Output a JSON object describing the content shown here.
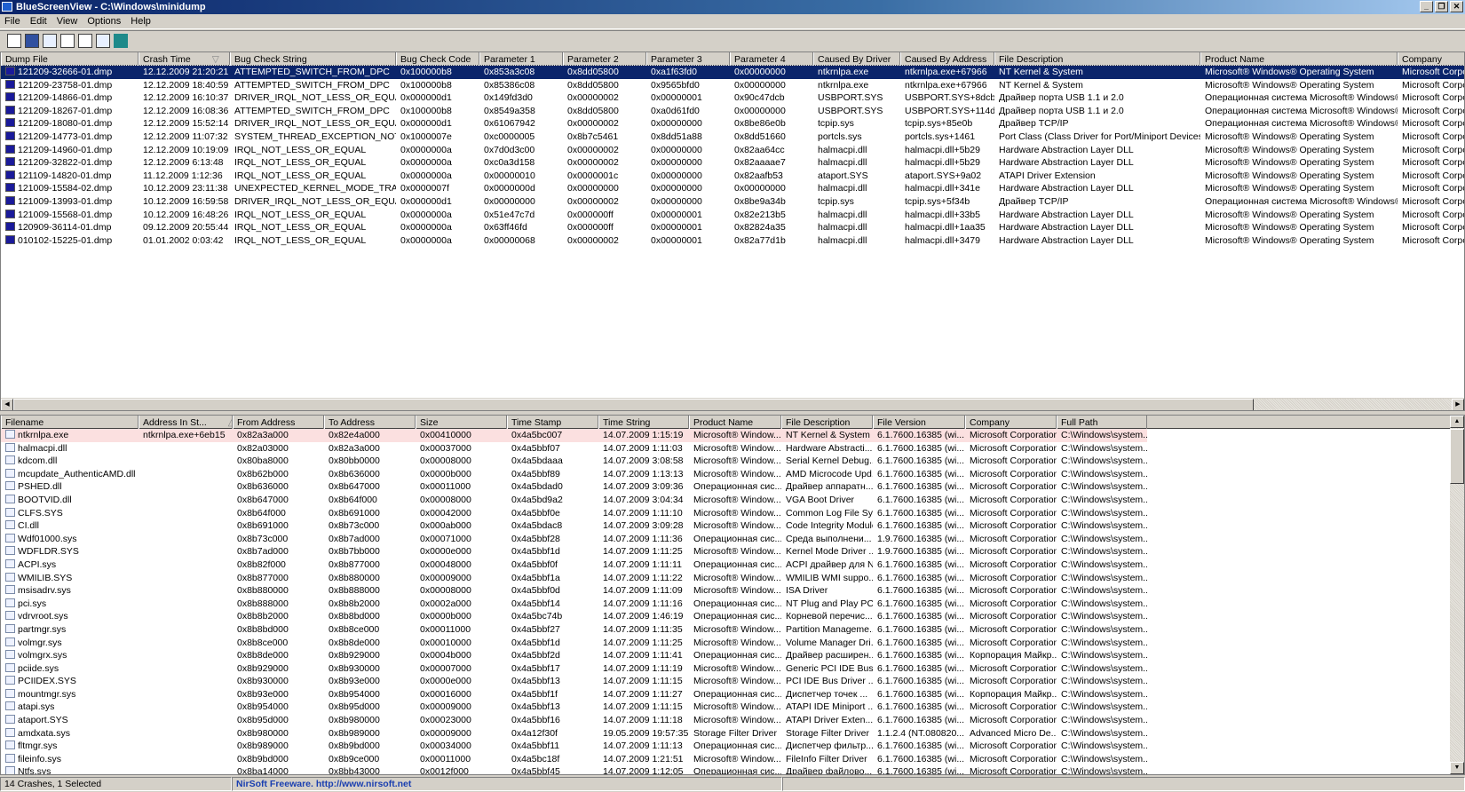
{
  "window": {
    "title": "BlueScreenView  -  C:\\Windows\\minidump",
    "minimize": "_",
    "restore": "❐",
    "close": "✕"
  },
  "menu": [
    "File",
    "Edit",
    "View",
    "Options",
    "Help"
  ],
  "toolbar": [
    "properties-icon",
    "save-icon",
    "refresh-icon",
    "copy-icon",
    "options-icon",
    "find-icon",
    "exit-icon"
  ],
  "crashes": {
    "columns": [
      "Dump File",
      "Crash Time",
      "Bug Check String",
      "Bug Check Code",
      "Parameter 1",
      "Parameter 2",
      "Parameter 3",
      "Parameter 4",
      "Caused By Driver",
      "Caused By Address",
      "File Description",
      "Product Name",
      "Company"
    ],
    "sort_column": "Crash Time",
    "sort_indicator": "▽",
    "selected_index": 0,
    "rows": [
      [
        "121209-32666-01.dmp",
        "12.12.2009 21:20:21",
        "ATTEMPTED_SWITCH_FROM_DPC",
        "0x100000b8",
        "0x853a3c08",
        "0x8dd05800",
        "0xa1f63fd0",
        "0x00000000",
        "ntkrnlpa.exe",
        "ntkrnlpa.exe+67966",
        "NT Kernel & System",
        "Microsoft® Windows® Operating System",
        "Microsoft Corpora"
      ],
      [
        "121209-23758-01.dmp",
        "12.12.2009 18:40:59",
        "ATTEMPTED_SWITCH_FROM_DPC",
        "0x100000b8",
        "0x85386c08",
        "0x8dd05800",
        "0x9565bfd0",
        "0x00000000",
        "ntkrnlpa.exe",
        "ntkrnlpa.exe+67966",
        "NT Kernel & System",
        "Microsoft® Windows® Operating System",
        "Microsoft Corpora"
      ],
      [
        "121209-14866-01.dmp",
        "12.12.2009 16:10:37",
        "DRIVER_IRQL_NOT_LESS_OR_EQUAL",
        "0x000000d1",
        "0x149fd3d0",
        "0x00000002",
        "0x00000001",
        "0x90c47dcb",
        "USBPORT.SYS",
        "USBPORT.SYS+8dcb",
        "Драйвер порта USB 1.1 и 2.0",
        "Операционная система Microsoft® Windows®",
        "Microsoft Corpora"
      ],
      [
        "121209-18267-01.dmp",
        "12.12.2009 16:08:36",
        "ATTEMPTED_SWITCH_FROM_DPC",
        "0x100000b8",
        "0x8549a358",
        "0x8dd05800",
        "0xa0d61fd0",
        "0x00000000",
        "USBPORT.SYS",
        "USBPORT.SYS+114d",
        "Драйвер порта USB 1.1 и 2.0",
        "Операционная система Microsoft® Windows®",
        "Microsoft Corpora"
      ],
      [
        "121209-18080-01.dmp",
        "12.12.2009 15:52:14",
        "DRIVER_IRQL_NOT_LESS_OR_EQUAL",
        "0x000000d1",
        "0x61067942",
        "0x00000002",
        "0x00000000",
        "0x8be86e0b",
        "tcpip.sys",
        "tcpip.sys+85e0b",
        "Драйвер TCP/IP",
        "Операционная система Microsoft® Windows®",
        "Microsoft Corpora"
      ],
      [
        "121209-14773-01.dmp",
        "12.12.2009 11:07:32",
        "SYSTEM_THREAD_EXCEPTION_NOT_H...",
        "0x1000007e",
        "0xc0000005",
        "0x8b7c5461",
        "0x8dd51a88",
        "0x8dd51660",
        "portcls.sys",
        "portcls.sys+1461",
        "Port Class (Class Driver for Port/Miniport Devices)",
        "Microsoft® Windows® Operating System",
        "Microsoft Corpora"
      ],
      [
        "121209-14960-01.dmp",
        "12.12.2009 10:19:09",
        "IRQL_NOT_LESS_OR_EQUAL",
        "0x0000000a",
        "0x7d0d3c00",
        "0x00000002",
        "0x00000000",
        "0x82aa64cc",
        "halmacpi.dll",
        "halmacpi.dll+5b29",
        "Hardware Abstraction Layer DLL",
        "Microsoft® Windows® Operating System",
        "Microsoft Corpora"
      ],
      [
        "121209-32822-01.dmp",
        "12.12.2009 6:13:48",
        "IRQL_NOT_LESS_OR_EQUAL",
        "0x0000000a",
        "0xc0a3d158",
        "0x00000002",
        "0x00000000",
        "0x82aaaae7",
        "halmacpi.dll",
        "halmacpi.dll+5b29",
        "Hardware Abstraction Layer DLL",
        "Microsoft® Windows® Operating System",
        "Microsoft Corpora"
      ],
      [
        "121109-14820-01.dmp",
        "11.12.2009 1:12:36",
        "IRQL_NOT_LESS_OR_EQUAL",
        "0x0000000a",
        "0x00000010",
        "0x0000001c",
        "0x00000000",
        "0x82aafb53",
        "ataport.SYS",
        "ataport.SYS+9a02",
        "ATAPI Driver Extension",
        "Microsoft® Windows® Operating System",
        "Microsoft Corpora"
      ],
      [
        "121009-15584-02.dmp",
        "10.12.2009 23:11:38",
        "UNEXPECTED_KERNEL_MODE_TRAP",
        "0x0000007f",
        "0x0000000d",
        "0x00000000",
        "0x00000000",
        "0x00000000",
        "halmacpi.dll",
        "halmacpi.dll+341e",
        "Hardware Abstraction Layer DLL",
        "Microsoft® Windows® Operating System",
        "Microsoft Corpora"
      ],
      [
        "121009-13993-01.dmp",
        "10.12.2009 16:59:58",
        "DRIVER_IRQL_NOT_LESS_OR_EQUAL",
        "0x000000d1",
        "0x00000000",
        "0x00000002",
        "0x00000000",
        "0x8be9a34b",
        "tcpip.sys",
        "tcpip.sys+5f34b",
        "Драйвер TCP/IP",
        "Операционная система Microsoft® Windows®",
        "Microsoft Corpora"
      ],
      [
        "121009-15568-01.dmp",
        "10.12.2009 16:48:26",
        "IRQL_NOT_LESS_OR_EQUAL",
        "0x0000000a",
        "0x51e47c7d",
        "0x000000ff",
        "0x00000001",
        "0x82e213b5",
        "halmacpi.dll",
        "halmacpi.dll+33b5",
        "Hardware Abstraction Layer DLL",
        "Microsoft® Windows® Operating System",
        "Microsoft Corpora"
      ],
      [
        "120909-36114-01.dmp",
        "09.12.2009 20:55:44",
        "IRQL_NOT_LESS_OR_EQUAL",
        "0x0000000a",
        "0x63ff46fd",
        "0x000000ff",
        "0x00000001",
        "0x82824a35",
        "halmacpi.dll",
        "halmacpi.dll+1aa35",
        "Hardware Abstraction Layer DLL",
        "Microsoft® Windows® Operating System",
        "Microsoft Corpora"
      ],
      [
        "010102-15225-01.dmp",
        "01.01.2002 0:03:42",
        "IRQL_NOT_LESS_OR_EQUAL",
        "0x0000000a",
        "0x00000068",
        "0x00000002",
        "0x00000001",
        "0x82a77d1b",
        "halmacpi.dll",
        "halmacpi.dll+3479",
        "Hardware Abstraction Layer DLL",
        "Microsoft® Windows® Operating System",
        "Microsoft Corpora"
      ]
    ]
  },
  "modules": {
    "columns": [
      "Filename",
      "Address In St...",
      "From Address",
      "To Address",
      "Size",
      "Time Stamp",
      "Time String",
      "Product Name",
      "File Description",
      "File Version",
      "Company",
      "Full Path"
    ],
    "sort_column": "Address In St...",
    "sort_indicator": "△",
    "highlight_index": 0,
    "highlight_color": "#fbe0e0",
    "rows": [
      [
        "ntkrnlpa.exe",
        "ntkrnlpa.exe+6eb15",
        "0x82a3a000",
        "0x82e4a000",
        "0x00410000",
        "0x4a5bc007",
        "14.07.2009 1:15:19",
        "Microsoft® Window...",
        "NT Kernel & System",
        "6.1.7600.16385 (wi...",
        "Microsoft Corporation",
        "C:\\Windows\\system..."
      ],
      [
        "halmacpi.dll",
        "",
        "0x82a03000",
        "0x82a3a000",
        "0x00037000",
        "0x4a5bbf07",
        "14.07.2009 1:11:03",
        "Microsoft® Window...",
        "Hardware Abstracti...",
        "6.1.7600.16385 (wi...",
        "Microsoft Corporation",
        "C:\\Windows\\system..."
      ],
      [
        "kdcom.dll",
        "",
        "0x80ba8000",
        "0x80bb0000",
        "0x00008000",
        "0x4a5bdaaa",
        "14.07.2009 3:08:58",
        "Microsoft® Window...",
        "Serial Kernel Debug...",
        "6.1.7600.16385 (wi...",
        "Microsoft Corporation",
        "C:\\Windows\\system..."
      ],
      [
        "mcupdate_AuthenticAMD.dll",
        "",
        "0x8b62b000",
        "0x8b636000",
        "0x0000b000",
        "0x4a5bbf89",
        "14.07.2009 1:13:13",
        "Microsoft® Window...",
        "AMD Microcode Upd...",
        "6.1.7600.16385 (wi...",
        "Microsoft Corporation",
        "C:\\Windows\\system..."
      ],
      [
        "PSHED.dll",
        "",
        "0x8b636000",
        "0x8b647000",
        "0x00011000",
        "0x4a5bdad0",
        "14.07.2009 3:09:36",
        "Операционная сис...",
        "Драйвер аппаратн...",
        "6.1.7600.16385 (wi...",
        "Microsoft Corporation",
        "C:\\Windows\\system..."
      ],
      [
        "BOOTVID.dll",
        "",
        "0x8b647000",
        "0x8b64f000",
        "0x00008000",
        "0x4a5bd9a2",
        "14.07.2009 3:04:34",
        "Microsoft® Window...",
        "VGA Boot Driver",
        "6.1.7600.16385 (wi...",
        "Microsoft Corporation",
        "C:\\Windows\\system..."
      ],
      [
        "CLFS.SYS",
        "",
        "0x8b64f000",
        "0x8b691000",
        "0x00042000",
        "0x4a5bbf0e",
        "14.07.2009 1:11:10",
        "Microsoft® Window...",
        "Common Log File Sy...",
        "6.1.7600.16385 (wi...",
        "Microsoft Corporation",
        "C:\\Windows\\system..."
      ],
      [
        "CI.dll",
        "",
        "0x8b691000",
        "0x8b73c000",
        "0x000ab000",
        "0x4a5bdac8",
        "14.07.2009 3:09:28",
        "Microsoft® Window...",
        "Code Integrity Module",
        "6.1.7600.16385 (wi...",
        "Microsoft Corporation",
        "C:\\Windows\\system..."
      ],
      [
        "Wdf01000.sys",
        "",
        "0x8b73c000",
        "0x8b7ad000",
        "0x00071000",
        "0x4a5bbf28",
        "14.07.2009 1:11:36",
        "Операционная сис...",
        "Среда выполнени...",
        "1.9.7600.16385 (wi...",
        "Microsoft Corporation",
        "C:\\Windows\\system..."
      ],
      [
        "WDFLDR.SYS",
        "",
        "0x8b7ad000",
        "0x8b7bb000",
        "0x0000e000",
        "0x4a5bbf1d",
        "14.07.2009 1:11:25",
        "Microsoft® Window...",
        "Kernel Mode Driver ...",
        "1.9.7600.16385 (wi...",
        "Microsoft Corporation",
        "C:\\Windows\\system..."
      ],
      [
        "ACPI.sys",
        "",
        "0x8b82f000",
        "0x8b877000",
        "0x00048000",
        "0x4a5bbf0f",
        "14.07.2009 1:11:11",
        "Операционная сис...",
        "ACPI драйвер для NT",
        "6.1.7600.16385 (wi...",
        "Microsoft Corporation",
        "C:\\Windows\\system..."
      ],
      [
        "WMILIB.SYS",
        "",
        "0x8b877000",
        "0x8b880000",
        "0x00009000",
        "0x4a5bbf1a",
        "14.07.2009 1:11:22",
        "Microsoft® Window...",
        "WMILIB WMI suppo...",
        "6.1.7600.16385 (wi...",
        "Microsoft Corporation",
        "C:\\Windows\\system..."
      ],
      [
        "msisadrv.sys",
        "",
        "0x8b880000",
        "0x8b888000",
        "0x00008000",
        "0x4a5bbf0d",
        "14.07.2009 1:11:09",
        "Microsoft® Window...",
        "ISA Driver",
        "6.1.7600.16385 (wi...",
        "Microsoft Corporation",
        "C:\\Windows\\system..."
      ],
      [
        "pci.sys",
        "",
        "0x8b888000",
        "0x8b8b2000",
        "0x0002a000",
        "0x4a5bbf14",
        "14.07.2009 1:11:16",
        "Операционная сис...",
        "NT Plug and Play PC...",
        "6.1.7600.16385 (wi...",
        "Microsoft Corporation",
        "C:\\Windows\\system..."
      ],
      [
        "vdrvroot.sys",
        "",
        "0x8b8b2000",
        "0x8b8bd000",
        "0x0000b000",
        "0x4a5bc74b",
        "14.07.2009 1:46:19",
        "Операционная сис...",
        "Корневой перечис...",
        "6.1.7600.16385 (wi...",
        "Microsoft Corporation",
        "C:\\Windows\\system..."
      ],
      [
        "partmgr.sys",
        "",
        "0x8b8bd000",
        "0x8b8ce000",
        "0x00011000",
        "0x4a5bbf27",
        "14.07.2009 1:11:35",
        "Microsoft® Window...",
        "Partition Manageme...",
        "6.1.7600.16385 (wi...",
        "Microsoft Corporation",
        "C:\\Windows\\system..."
      ],
      [
        "volmgr.sys",
        "",
        "0x8b8ce000",
        "0x8b8de000",
        "0x00010000",
        "0x4a5bbf1d",
        "14.07.2009 1:11:25",
        "Microsoft® Window...",
        "Volume Manager Dri...",
        "6.1.7600.16385 (wi...",
        "Microsoft Corporation",
        "C:\\Windows\\system..."
      ],
      [
        "volmgrx.sys",
        "",
        "0x8b8de000",
        "0x8b929000",
        "0x0004b000",
        "0x4a5bbf2d",
        "14.07.2009 1:11:41",
        "Операционная сис...",
        "Драйвер расширен...",
        "6.1.7600.16385 (wi...",
        "Корпорация Майкр...",
        "C:\\Windows\\system..."
      ],
      [
        "pciide.sys",
        "",
        "0x8b929000",
        "0x8b930000",
        "0x00007000",
        "0x4a5bbf17",
        "14.07.2009 1:11:19",
        "Microsoft® Window...",
        "Generic PCI IDE Bus...",
        "6.1.7600.16385 (wi...",
        "Microsoft Corporation",
        "C:\\Windows\\system..."
      ],
      [
        "PCIIDEX.SYS",
        "",
        "0x8b930000",
        "0x8b93e000",
        "0x0000e000",
        "0x4a5bbf13",
        "14.07.2009 1:11:15",
        "Microsoft® Window...",
        "PCI IDE Bus Driver ...",
        "6.1.7600.16385 (wi...",
        "Microsoft Corporation",
        "C:\\Windows\\system..."
      ],
      [
        "mountmgr.sys",
        "",
        "0x8b93e000",
        "0x8b954000",
        "0x00016000",
        "0x4a5bbf1f",
        "14.07.2009 1:11:27",
        "Операционная сис...",
        "Диспетчер точек ...",
        "6.1.7600.16385 (wi...",
        "Корпорация Майкр...",
        "C:\\Windows\\system..."
      ],
      [
        "atapi.sys",
        "",
        "0x8b954000",
        "0x8b95d000",
        "0x00009000",
        "0x4a5bbf13",
        "14.07.2009 1:11:15",
        "Microsoft® Window...",
        "ATAPI IDE Miniport ...",
        "6.1.7600.16385 (wi...",
        "Microsoft Corporation",
        "C:\\Windows\\system..."
      ],
      [
        "ataport.SYS",
        "",
        "0x8b95d000",
        "0x8b980000",
        "0x00023000",
        "0x4a5bbf16",
        "14.07.2009 1:11:18",
        "Microsoft® Window...",
        "ATAPI Driver Exten...",
        "6.1.7600.16385 (wi...",
        "Microsoft Corporation",
        "C:\\Windows\\system..."
      ],
      [
        "amdxata.sys",
        "",
        "0x8b980000",
        "0x8b989000",
        "0x00009000",
        "0x4a12f30f",
        "19.05.2009 19:57:35",
        "Storage Filter Driver",
        "Storage Filter Driver",
        "1.1.2.4 (NT.080820...",
        "Advanced Micro De...",
        "C:\\Windows\\system..."
      ],
      [
        "fltmgr.sys",
        "",
        "0x8b989000",
        "0x8b9bd000",
        "0x00034000",
        "0x4a5bbf11",
        "14.07.2009 1:11:13",
        "Операционная сис...",
        "Диспетчер фильтр...",
        "6.1.7600.16385 (wi...",
        "Microsoft Corporation",
        "C:\\Windows\\system..."
      ],
      [
        "fileinfo.sys",
        "",
        "0x8b9bd000",
        "0x8b9ce000",
        "0x00011000",
        "0x4a5bc18f",
        "14.07.2009 1:21:51",
        "Microsoft® Window...",
        "FileInfo Filter Driver",
        "6.1.7600.16385 (wi...",
        "Microsoft Corporation",
        "C:\\Windows\\system..."
      ],
      [
        "Ntfs.sys",
        "",
        "0x8ba14000",
        "0x8bb43000",
        "0x0012f000",
        "0x4a5bbf45",
        "14.07.2009 1:12:05",
        "Операционная сис...",
        "Драйвер файлово...",
        "6.1.7600.16385 (wi...",
        "Microsoft Corporation",
        "C:\\Windows\\system..."
      ]
    ]
  },
  "status": {
    "count": "14 Crashes, 1 Selected",
    "credit": "NirSoft Freeware.  http://www.nirsoft.net"
  }
}
